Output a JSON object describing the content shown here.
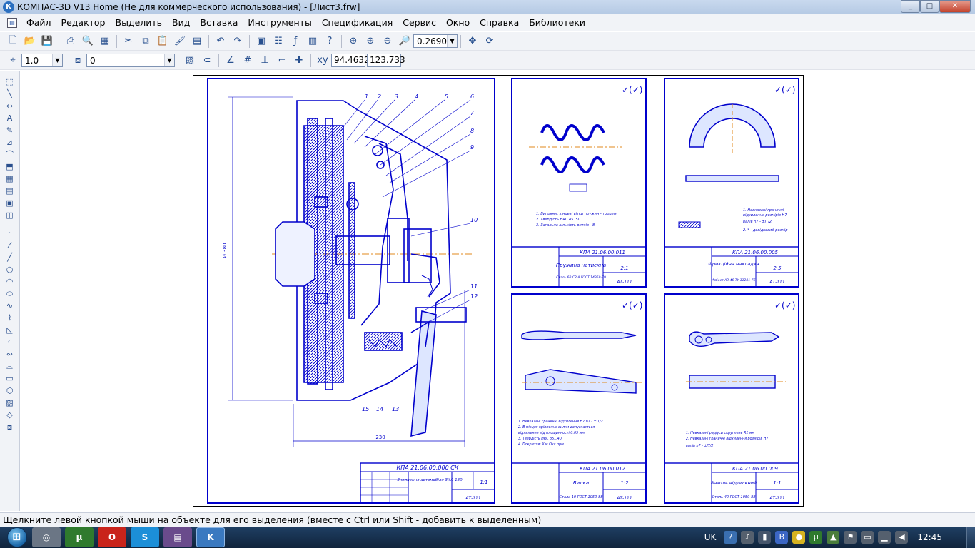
{
  "window": {
    "title": "КОМПАС-3D V13 Home (Не для коммерческого использования) - [Лист3.frw]",
    "minimize": "_",
    "maximize": "□",
    "close": "✕"
  },
  "menu": {
    "items": [
      "Файл",
      "Редактор",
      "Выделить",
      "Вид",
      "Вставка",
      "Инструменты",
      "Спецификация",
      "Сервис",
      "Окно",
      "Справка",
      "Библиотеки"
    ],
    "doc_min": "_",
    "doc_restore": "❐",
    "doc_close": "✕"
  },
  "toolbar1": {
    "zoom_value": "0.2690"
  },
  "toolbar2": {
    "step_value": "1.0",
    "layer_value": "0",
    "coord_x": "94.4632",
    "coord_y": "123.733"
  },
  "drawing": {
    "main_doc": "КПА 21.06.00.000 СК",
    "main_name": "Зчеплення автомобіля ЗИЛ-130",
    "main_scale": "1:1",
    "main_org": "АТ-111",
    "sheets": [
      {
        "doc": "КПА 21.06.00.011",
        "name": "Пружина натискна",
        "material": "Сталь 60 С2 А ГОСТ 14959-79",
        "scale": "2:1",
        "org": "АТ-111"
      },
      {
        "doc": "КПА 21.06.00.005",
        "name": "Фрикційна накладка",
        "material": "Азбест АЗ-46 ТУ 11281-75",
        "scale": "2.5",
        "org": "АТ-111"
      },
      {
        "doc": "КПА 21.06.00.012",
        "name": "Вилка",
        "material": "Сталь 10 ГОСТ 1050-88",
        "scale": "1:2",
        "org": "АТ-111"
      },
      {
        "doc": "КПА 21.06.00.009",
        "name": "Важіль відтискний",
        "material": "Сталь 40 ГОСТ 1050-88",
        "scale": "1:1",
        "org": "АТ-111"
      }
    ],
    "callouts": [
      "1",
      "2",
      "3",
      "4",
      "5",
      "6",
      "7",
      "8",
      "9",
      "10",
      "11",
      "12",
      "13",
      "14",
      "15"
    ],
    "dims": {
      "height": "Ø 380",
      "width": "230"
    },
    "notes_spring": [
      "1. Випрямл. кінцеві вітки пружин - торцем.",
      "2. Твердість HRC 45..50.",
      "3. Загальна кількість витків - 8."
    ],
    "notes_lining": [
      "1. Невказані граничні",
      "відхилення розмірів Н7",
      "валів h7 - ±IT/2",
      "2. * - довідковий розмір"
    ],
    "notes_fork": [
      "1. Невказані граничні відхилення Н7 h7 - ±IT/2",
      "2. В місцях кріплення вилки допускається",
      "відхилення від площинності 0.05 мм",
      "3. Твердість HRC 35...40",
      "4. Покриття: Хім.Окс.прм."
    ],
    "notes_lever": [
      "1. Невказані радіуси скруглень R1 мм",
      "2. Невказані граничні відхилення розмірів Н7",
      "валів h7 - ±IT/2"
    ]
  },
  "status": {
    "text": "Щелкните левой кнопкой мыши на объекте для его выделения (вместе с Ctrl или Shift - добавить к выделенным)"
  },
  "taskbar": {
    "lang": "UK",
    "time": "12:45"
  },
  "colors": {
    "drawing_line": "#0000cc",
    "center_line": "#e08a1e",
    "titlebar": "#b9cde6"
  }
}
